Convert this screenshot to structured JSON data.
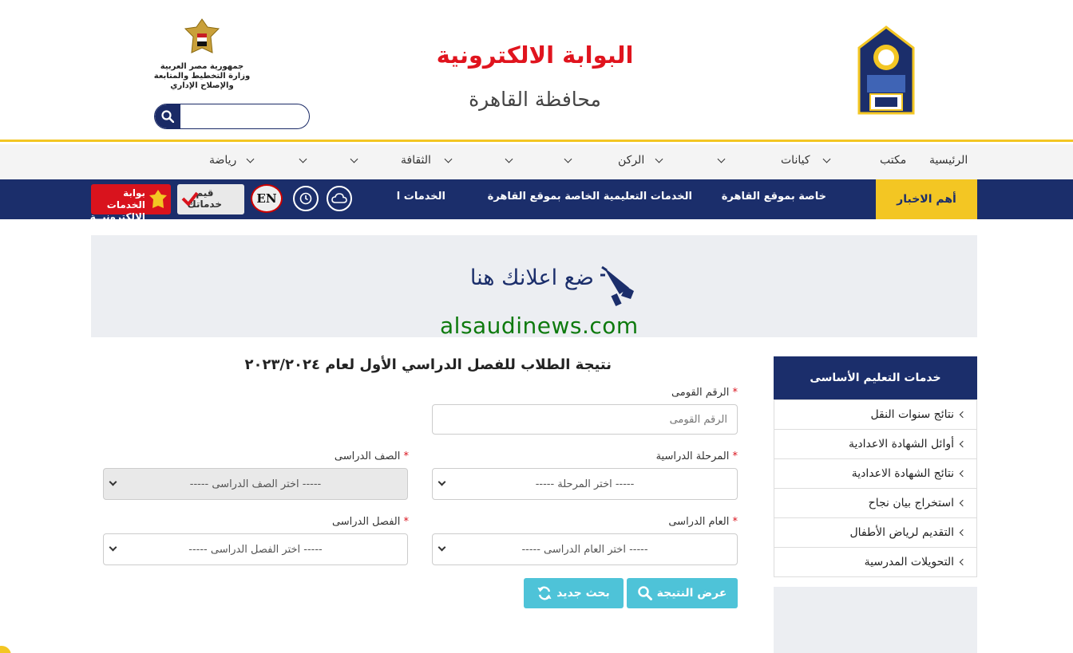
{
  "header": {
    "portal_title": "البوابة الالكترونية",
    "governorate": "محافظة القاهرة",
    "ministry_line1": "جمهورية مصر العربية",
    "ministry_line2": "وزارة التخطيط والمتابعة والإصلاح الإداري",
    "search": {
      "placeholder": "",
      "value": ""
    }
  },
  "nav": {
    "items": [
      {
        "label": "الرئيسية",
        "dropdown": false
      },
      {
        "label": "مكتب",
        "dropdown": true
      },
      {
        "label": "كيانات",
        "dropdown": true
      },
      {
        "label": "",
        "dropdown": true
      },
      {
        "label": "الركن",
        "dropdown": true
      },
      {
        "label": "",
        "dropdown": true
      },
      {
        "label": "",
        "dropdown": true
      },
      {
        "label": "الثقافة",
        "dropdown": true
      },
      {
        "label": "",
        "dropdown": true
      },
      {
        "label": "",
        "dropdown": true
      },
      {
        "label": "رياضة",
        "dropdown": true
      }
    ]
  },
  "news": {
    "label": "أهم الاخبار",
    "ticker": [
      "خاصة بموقع القاهرة",
      "الخدمات التعليمية الخاصة بموقع القاهرة",
      "الخدمات ا"
    ]
  },
  "badges": {
    "en": "EN",
    "rate_line1": "قيم",
    "rate_line2": "خدماتك",
    "eservices_line1": "بوابة الخدمات",
    "eservices_line2": "الإلكترونيــة"
  },
  "ad": {
    "text": "ضع اعلانك هنا",
    "watermark": "alsaudinews.com"
  },
  "form": {
    "title": "نتيجة الطلاب للفصل الدراسي الأول لعام ٢٠٢٣/٢٠٢٤",
    "national_id_label": "الرقم القومى",
    "national_id_placeholder": "الرقم القومى",
    "stage_label": "المرحلة الدراسية",
    "stage_value": "----- اختر المرحلة -----",
    "grade_label": "الصف الدراسى",
    "grade_value": "----- اختر الصف الدراسى -----",
    "year_label": "العام الدراسى",
    "year_value": "----- اختر العام الدراسى -----",
    "term_label": "الفصل الدراسى",
    "term_value": "----- اختر الفصل الدراسى -----",
    "required_mark": "*",
    "show_result_button": "عرض النتيجة",
    "new_search_button": "بحث جديد"
  },
  "sidebar": {
    "title": "خدمات التعليم الأساسى",
    "items": [
      "نتائج سنوات النقل",
      "أوائل الشهادة الاعدادية",
      "نتائج الشهادة الاعدادية",
      "استخراج بيان نجاح",
      "التقديم لرياض الأطفال",
      "التحويلات المدرسية"
    ]
  },
  "colors": {
    "navy": "#1b2e6b",
    "yellow": "#f3c623",
    "red": "#e0141e",
    "cyan_button": "#4ec3d8"
  }
}
